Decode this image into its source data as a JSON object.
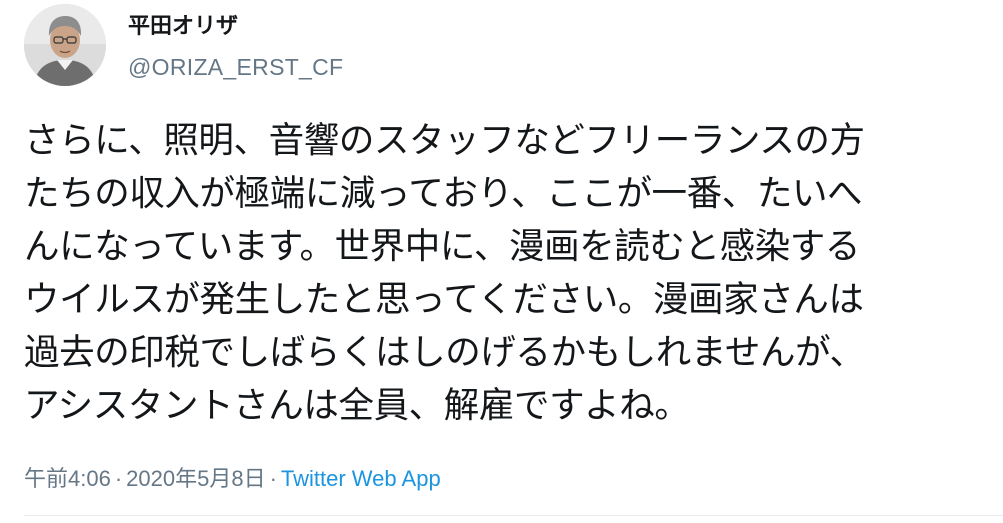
{
  "tweet": {
    "author": {
      "display_name": "平田オリザ",
      "handle": "@ORIZA_ERST_CF",
      "avatar_icon": "user-photo-avatar"
    },
    "text": "さらに、照明、音響のスタッフなどフリーランスの方\nたちの収入が極端に減っており、ここが一番、たいへ\nんになっています。世界中に、漫画を読むと感染する\nウイルスが発生したと思ってください。漫画家さんは\n過去の印税でしばらくはしのげるかもしれませんが、\nアシスタントさんは全員、解雇ですよね。",
    "meta": {
      "time": "午前4:06",
      "separator": "·",
      "date": "2020年5月8日",
      "source": "Twitter Web App"
    },
    "colors": {
      "text": "#14171a",
      "secondary": "#657786",
      "link": "#1b95e0",
      "divider": "#e6ecf0"
    }
  }
}
